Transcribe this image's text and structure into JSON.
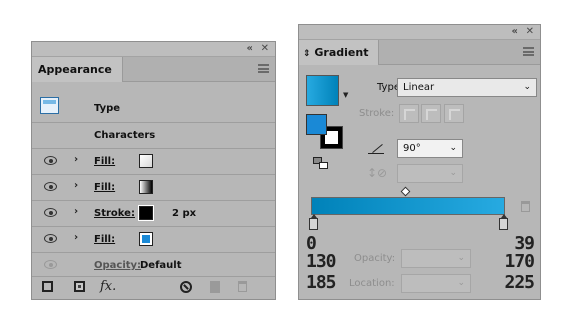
{
  "appearance": {
    "tab_label": "Appearance",
    "collapse": "«",
    "close": "✕",
    "type_label": "Type",
    "characters_label": "Characters",
    "rows": [
      {
        "label": "Fill:",
        "value": ""
      },
      {
        "label": "Fill:",
        "value": ""
      },
      {
        "label": "Stroke:",
        "value": "2 px"
      },
      {
        "label": "Fill:",
        "value": ""
      }
    ],
    "opacity_label": "Opacity:",
    "opacity_value": "Default",
    "fx_label": "fx."
  },
  "gradient": {
    "tab_label": "Gradient",
    "collapse": "«",
    "close": "✕",
    "type_label": "Type:",
    "type_value": "Linear",
    "stroke_label": "Stroke:",
    "angle_value": "90°",
    "opacity_label": "Opacity:",
    "location_label": "Location:",
    "left_rgb": [
      "0",
      "130",
      "185"
    ],
    "right_rgb": [
      "39",
      "170",
      "225"
    ],
    "colors": {
      "start": "#0082B9",
      "end": "#27AAE1"
    }
  }
}
